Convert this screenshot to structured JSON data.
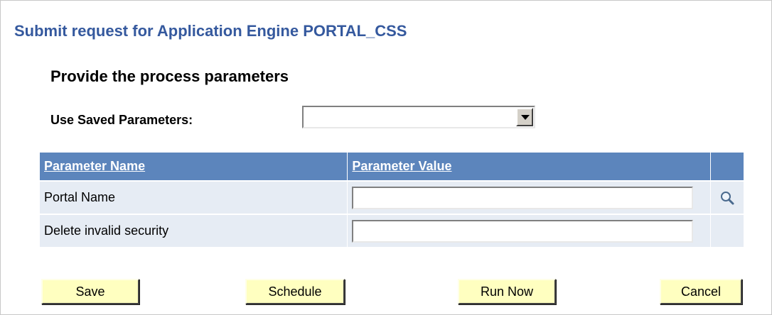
{
  "page": {
    "title": "Submit request for Application Engine PORTAL_CSS",
    "section_title": "Provide the process parameters",
    "saved_parameters_label": "Use Saved Parameters:",
    "saved_parameters_value": ""
  },
  "grid": {
    "headers": [
      "Parameter Name",
      "Parameter Value"
    ],
    "rows": [
      {
        "name": "Portal Name",
        "value": "",
        "has_lookup": true
      },
      {
        "name": "Delete invalid security",
        "value": "",
        "has_lookup": false
      }
    ]
  },
  "buttons": {
    "save": "Save",
    "schedule": "Schedule",
    "run_now": "Run Now",
    "cancel": "Cancel"
  },
  "icons": {
    "dropdown": "chevron-down-icon",
    "lookup": "magnifier-icon"
  },
  "colors": {
    "title": "#35599e",
    "grid_header": "#5c85bc",
    "grid_row": "#e6ecf4",
    "button_bg": "#ffffc0"
  }
}
